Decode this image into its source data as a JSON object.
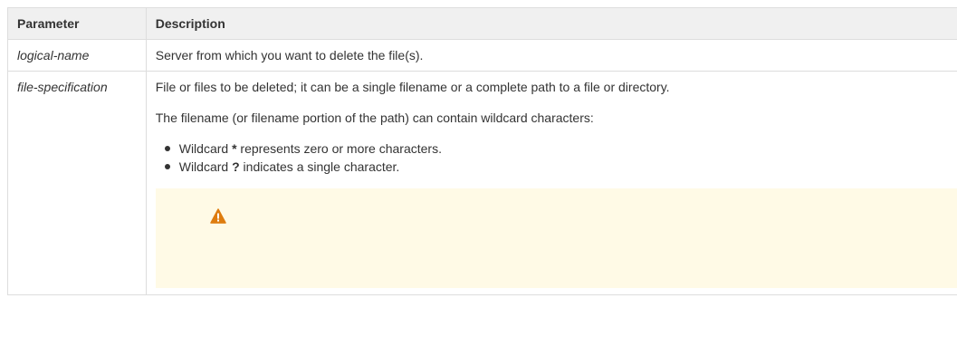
{
  "table": {
    "headers": {
      "parameter": "Parameter",
      "description": "Description"
    },
    "rows": [
      {
        "parameter": "logical-name",
        "description": "Server from which you want to delete the file(s)."
      },
      {
        "parameter": "file-specification",
        "paragraph1": "File or files to be deleted; it can be a single filename or a complete path to a file or directory.",
        "paragraph2": "The filename (or filename portion of the path) can contain wildcard characters:",
        "bullets": [
          {
            "prefix": "Wildcard ",
            "symbol": "*",
            "suffix": " represents zero or more characters."
          },
          {
            "prefix": "Wildcard ",
            "symbol": "?",
            "suffix": " indicates a single character."
          }
        ],
        "warning": {
          "icon": "warning-icon",
          "color": "#de7c0f",
          "background": "#fffae6"
        }
      }
    ]
  }
}
